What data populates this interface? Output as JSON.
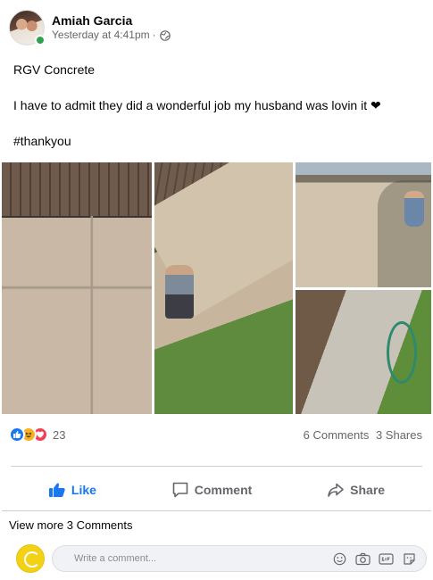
{
  "post": {
    "author": "Amiah Garcia",
    "timestamp": "Yesterday at 4:41pm",
    "separator": "·",
    "privacy_icon": "globe-icon",
    "text": {
      "line1": "RGV Concrete",
      "line2": "I have to admit they did a wonderful job my husband was lovin it ❤",
      "line3": "#thankyou"
    }
  },
  "reactions": {
    "icons": [
      "like-icon",
      "haha-icon",
      "love-icon"
    ],
    "count": "23",
    "comments": "6 Comments",
    "shares": "3 Shares"
  },
  "actions": {
    "like": "Like",
    "comment": "Comment",
    "share": "Share"
  },
  "comments": {
    "view_more": "View more 3 Comments",
    "placeholder": "Write a comment..."
  },
  "colors": {
    "accent": "#1877f2",
    "online": "#31a24c",
    "muted": "#65676b"
  }
}
